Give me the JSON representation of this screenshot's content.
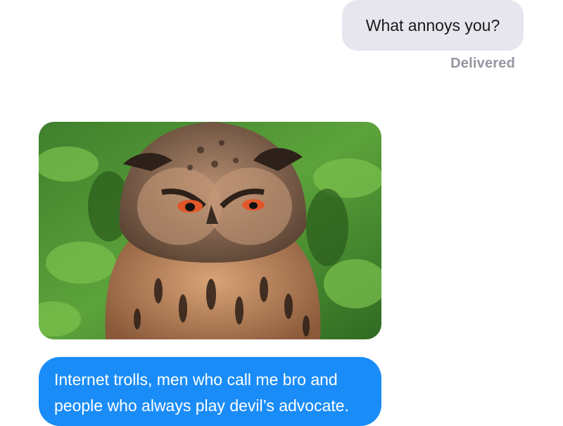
{
  "thread": {
    "outgoing_message": "What annoys you?",
    "delivery_status": "Delivered",
    "incoming_image": {
      "subject": "owl-photo-icon"
    },
    "incoming_message": "Internet trolls, men who call me bro and people who always play devil’s advocate."
  },
  "colors": {
    "outgoing_bubble": "#e7e6ee",
    "incoming_bubble": "#1a8cf7",
    "receipt_text": "#9a94a0"
  }
}
